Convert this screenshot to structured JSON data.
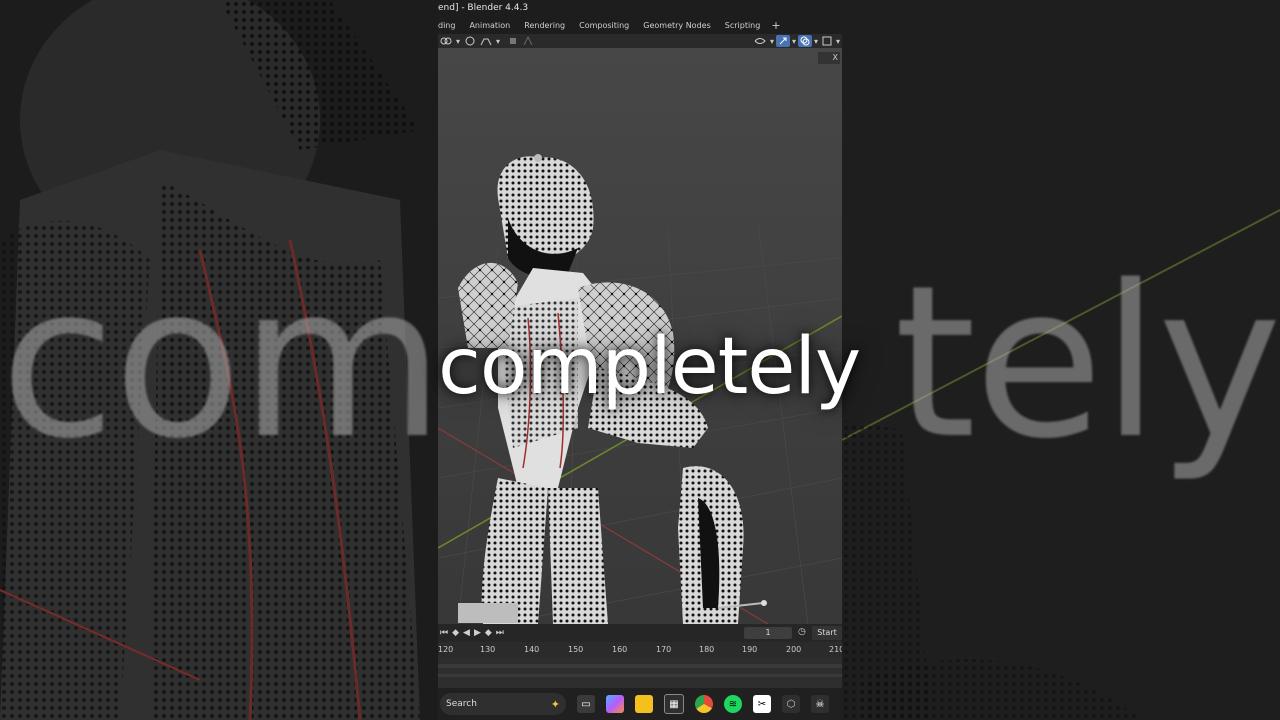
{
  "window": {
    "title": "end] - Blender 4.4.3"
  },
  "workspace_tabs": [
    "ding",
    "Animation",
    "Rendering",
    "Compositing",
    "Geometry Nodes",
    "Scripting"
  ],
  "add_tab_label": "+",
  "viewport": {
    "close_label": "X"
  },
  "caption": {
    "text": "completely",
    "side_left": "com",
    "side_right": "tely"
  },
  "timeline": {
    "current_frame": "1",
    "start_label": "Start",
    "ruler_ticks": [
      "120",
      "130",
      "140",
      "150",
      "160",
      "170",
      "180",
      "190",
      "200",
      "210"
    ]
  },
  "taskbar": {
    "search_placeholder": "Search",
    "apps": [
      {
        "name": "task-view-icon",
        "color": "#e8e8e8"
      },
      {
        "name": "copilot-icon",
        "color": "#7b61ff"
      },
      {
        "name": "file-explorer-icon",
        "color": "#f3c01d"
      },
      {
        "name": "store-icon",
        "color": "#ffffff"
      },
      {
        "name": "chrome-icon",
        "color": "#e64a3b"
      },
      {
        "name": "spotify-icon",
        "color": "#1ed760"
      },
      {
        "name": "capcut-icon",
        "color": "#ffffff"
      },
      {
        "name": "unity-icon",
        "color": "#cccccc"
      },
      {
        "name": "skull-app-icon",
        "color": "#ffffff"
      }
    ]
  }
}
